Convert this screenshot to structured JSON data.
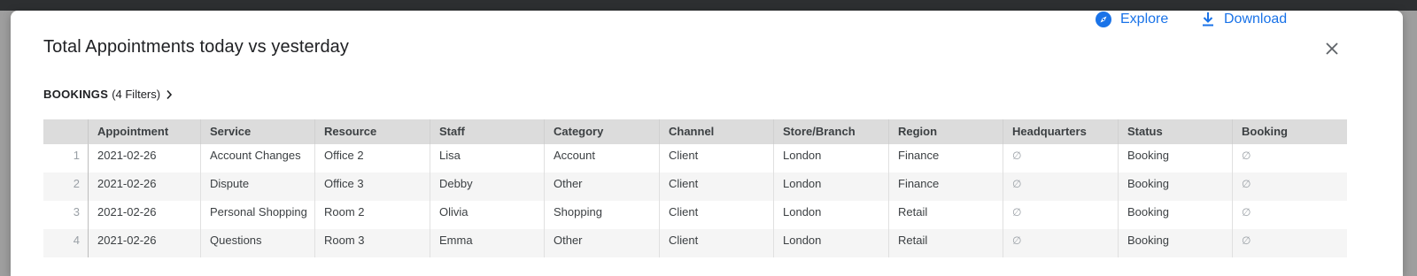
{
  "modal": {
    "title": "Total Appointments today vs yesterday",
    "explore_label": "Explore",
    "download_label": "Download",
    "breadcrumb_label": "BOOKINGS",
    "breadcrumb_filters": "(4 Filters)"
  },
  "colors": {
    "accent": "#1a73e8",
    "header_bg": "#dcdcdc",
    "stripe_bg": "#f5f5f5"
  },
  "table": {
    "columns": [
      "Appointment",
      "Service",
      "Resource",
      "Staff",
      "Category",
      "Channel",
      "Store/Branch",
      "Region",
      "Headquarters",
      "Status",
      "Booking"
    ],
    "rows": [
      {
        "index": "1",
        "cells": [
          "2021-02-26",
          "Account Changes",
          "Office 2",
          "Lisa",
          "Account",
          "Client",
          "London",
          "Finance",
          "∅",
          "Booking",
          "∅"
        ]
      },
      {
        "index": "2",
        "cells": [
          "2021-02-26",
          "Dispute",
          "Office 3",
          "Debby",
          "Other",
          "Client",
          "London",
          "Finance",
          "∅",
          "Booking",
          "∅"
        ]
      },
      {
        "index": "3",
        "cells": [
          "2021-02-26",
          "Personal Shopping",
          "Room 2",
          "Olivia",
          "Shopping",
          "Client",
          "London",
          "Retail",
          "∅",
          "Booking",
          "∅"
        ]
      },
      {
        "index": "4",
        "cells": [
          "2021-02-26",
          "Questions",
          "Room 3",
          "Emma",
          "Other",
          "Client",
          "London",
          "Retail",
          "∅",
          "Booking",
          "∅"
        ]
      }
    ]
  }
}
